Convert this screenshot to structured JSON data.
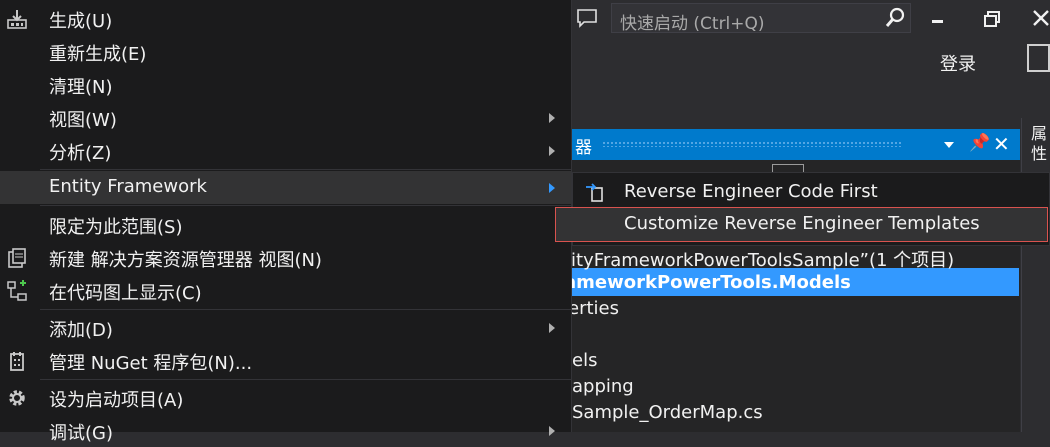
{
  "ide": {
    "quick_launch_placeholder": "快速启动 (Ctrl+Q)",
    "login_label": "登录",
    "properties_tab": "属性",
    "solution_explorer_title": "器",
    "tree": [
      "tityFrameworkPowerToolsSample”(1 个项目)",
      "ameworkPowerTools.Models",
      "erties",
      "",
      "els",
      "apping",
      " Sample_OrderMap.cs"
    ],
    "accent": "#007acc",
    "selection_color": "#3399ff"
  },
  "context_menu": {
    "items": [
      {
        "label": "生成(U)",
        "icon": "build-icon"
      },
      {
        "label": "重新生成(E)"
      },
      {
        "label": "清理(N)"
      },
      {
        "label": "视图(W)",
        "submenu": true
      },
      {
        "label": "分析(Z)",
        "submenu": true
      },
      {
        "label": "Entity Framework",
        "submenu": true,
        "highlighted": true
      },
      {
        "label": "限定为此范围(S)"
      },
      {
        "label": "新建 解决方案资源管理器 视图(N)",
        "icon": "new-view-icon"
      },
      {
        "label": "在代码图上显示(C)",
        "icon": "code-map-icon"
      },
      {
        "label": "添加(D)",
        "submenu": true
      },
      {
        "label": "管理 NuGet 程序包(N)...",
        "icon": "nuget-icon"
      },
      {
        "label": "设为启动项目(A)",
        "icon": "gear-icon"
      },
      {
        "label": "调试(G)",
        "submenu": true
      }
    ]
  },
  "submenu": {
    "items": [
      {
        "label": "Reverse Engineer Code First",
        "icon": "reverse-engineer-icon"
      },
      {
        "label": "Customize Reverse Engineer Templates",
        "highlighted": true
      }
    ],
    "highlight_border": "#d9534f"
  }
}
